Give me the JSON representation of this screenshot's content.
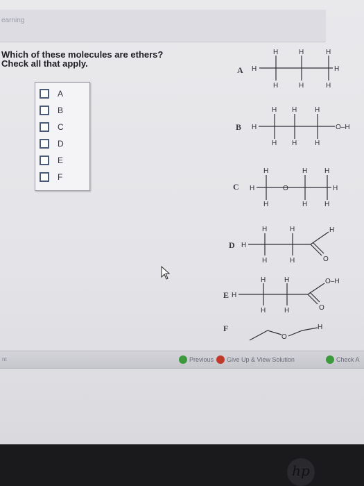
{
  "app": {
    "title": "earning"
  },
  "question": {
    "line1": "Which of these molecules are ethers?",
    "line2": "Check all that apply."
  },
  "choices": [
    {
      "label": "A",
      "checked": false
    },
    {
      "label": "B",
      "checked": false
    },
    {
      "label": "C",
      "checked": false
    },
    {
      "label": "D",
      "checked": false
    },
    {
      "label": "E",
      "checked": false
    },
    {
      "label": "F",
      "checked": false
    }
  ],
  "molecules": [
    {
      "letter": "A",
      "atom": "H"
    },
    {
      "letter": "B",
      "atom": "H",
      "group": "O–H"
    },
    {
      "letter": "C",
      "atom": "H",
      "oxygen": "O"
    },
    {
      "letter": "D",
      "atom": "H",
      "oxygen": "O"
    },
    {
      "letter": "E",
      "atom": "H",
      "oxygen": "O",
      "group": "O–H"
    },
    {
      "letter": "F",
      "oxygen": "O",
      "atom": "H"
    }
  ],
  "footer": {
    "left": "nt",
    "previous": "Previous",
    "give_up": "Give Up & View Solution",
    "check": "Check A"
  },
  "colors": {
    "accent_green": "#3c9a3c",
    "give_up_red": "#c0392b",
    "checkbox_border": "#4b5a78"
  },
  "brand": {
    "logo": "hp"
  }
}
